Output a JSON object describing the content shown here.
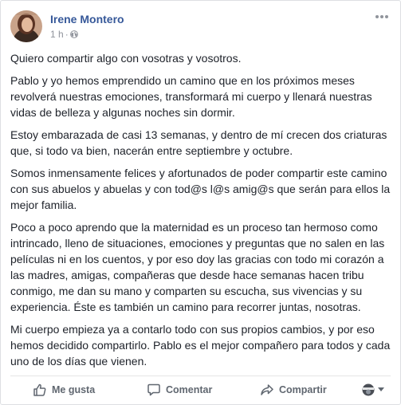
{
  "post": {
    "author": "Irene Montero",
    "time": "1 h",
    "separator": "·",
    "privacy_icon": "public-globe-icon",
    "paragraphs": [
      "Quiero compartir algo con vosotras y vosotros.",
      "Pablo y yo hemos emprendido un camino que en los próximos meses revolverá nuestras emociones, transformará mi cuerpo y llenará nuestras vidas de belleza y algunas noches sin dormir.",
      "Estoy embarazada de casi 13 semanas, y dentro de mí crecen dos criaturas que, si todo va bien, nacerán entre septiembre y octubre.",
      "Somos inmensamente felices y afortunados de poder compartir este camino con sus abuelos y abuelas y con tod@s l@s amig@s que serán para ellos la mejor familia.",
      "Poco a poco aprendo que la maternidad es un proceso tan hermoso como intrincado, lleno de situaciones, emociones y preguntas que no salen en las películas ni en los cuentos, y por eso doy las gracias con todo mi corazón a las madres, amigas, compañeras que desde hace semanas hacen tribu conmigo, me dan su mano y comparten su escucha, sus vivencias y su experiencia. Éste es también un camino para recorrer juntas, nosotras.",
      "Mi cuerpo empieza ya a contarlo todo con sus propios cambios, y por eso hemos decidido compartirlo. Pablo es el mejor compañero para todos y cada uno de los días que vienen."
    ]
  },
  "actions": {
    "like_label": "Me gusta",
    "comment_label": "Comentar",
    "share_label": "Compartir"
  },
  "colors": {
    "author": "#365899",
    "text": "#1d2129",
    "muted": "#90949c",
    "action": "#606770"
  }
}
